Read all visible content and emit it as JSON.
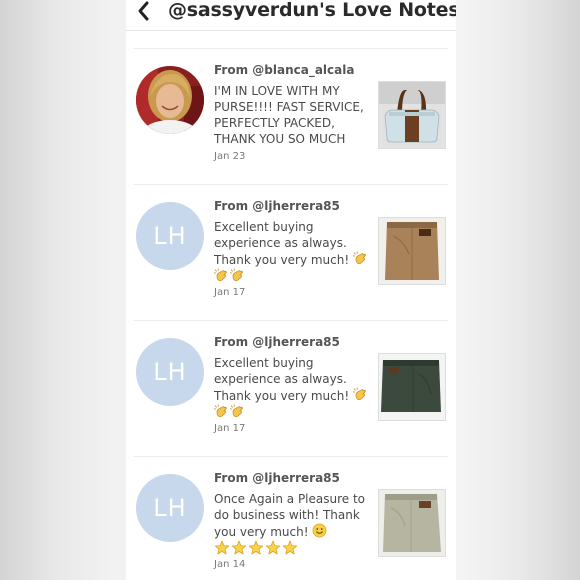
{
  "header": {
    "back_icon": "chevron-left-icon",
    "title": "@sassyverdun's Love Notes"
  },
  "notes": [
    {
      "from": "From @blanca_alcala",
      "message_lines": [
        "I'M IN LOVE WITH MY",
        "PURSE!!!! FAST SERVICE,",
        "PERFECTLY PACKED,",
        "THANK YOU SO MUCH"
      ],
      "date": "Jan 23",
      "avatar_type": "photo",
      "item": "white leather purse with brown handles"
    },
    {
      "from": "From @ljherrera85",
      "message_lines": [
        "Excellent buying",
        "experience as always.",
        "Thank you very much!"
      ],
      "emojis": [
        "clapping-hands-icon",
        "clapping-hands-icon",
        "clapping-hands-icon"
      ],
      "date": "Jan 17",
      "avatar_initials": "LH",
      "item": "tan corduroy pants"
    },
    {
      "from": "From @ljherrera85",
      "message_lines": [
        "Excellent buying",
        "experience as always.",
        "Thank you very much!"
      ],
      "emojis": [
        "clapping-hands-icon",
        "clapping-hands-icon",
        "clapping-hands-icon"
      ],
      "date": "Jan 17",
      "avatar_initials": "LH",
      "item": "dark olive pants"
    },
    {
      "from": "From @ljherrera85",
      "message_lines": [
        "Once Again a Pleasure to",
        "do business with! Thank",
        "you very much!"
      ],
      "emojis": [
        "smiling-face-icon",
        "star-icon",
        "star-icon",
        "star-icon",
        "star-icon",
        "star-icon"
      ],
      "date": "Jan 14",
      "avatar_initials": "LH",
      "item": "light khaki pants"
    }
  ],
  "colors": {
    "avatar_bg": "#c8d8ec",
    "title": "#2b2b2b",
    "text": "#4a4a4a",
    "date": "#7a7a7a"
  }
}
